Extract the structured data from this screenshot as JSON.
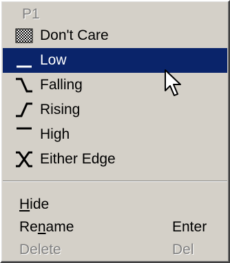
{
  "menu": {
    "header": "P1",
    "items": [
      {
        "label": "Don't Care",
        "icon": "dont-care-hatch-icon",
        "selected": false
      },
      {
        "label": "Low",
        "icon": "low-level-icon",
        "selected": true
      },
      {
        "label": "Falling",
        "icon": "falling-edge-icon",
        "selected": false
      },
      {
        "label": "Rising",
        "icon": "rising-edge-icon",
        "selected": false
      },
      {
        "label": "High",
        "icon": "high-level-icon",
        "selected": false
      },
      {
        "label": "Either Edge",
        "icon": "either-edge-icon",
        "selected": false
      }
    ],
    "commands": [
      {
        "label_u": "H",
        "label_rest": "ide",
        "shortcut": "",
        "disabled": false
      },
      {
        "label_pre": "Re",
        "label_u": "n",
        "label_rest": "ame",
        "shortcut": "Enter",
        "disabled": false
      },
      {
        "label": "Delete",
        "shortcut": "Del",
        "disabled": true
      }
    ]
  },
  "colors": {
    "menu_bg": "#d4d0c8",
    "selection": "#0a246a",
    "disabled_text": "#808080"
  }
}
